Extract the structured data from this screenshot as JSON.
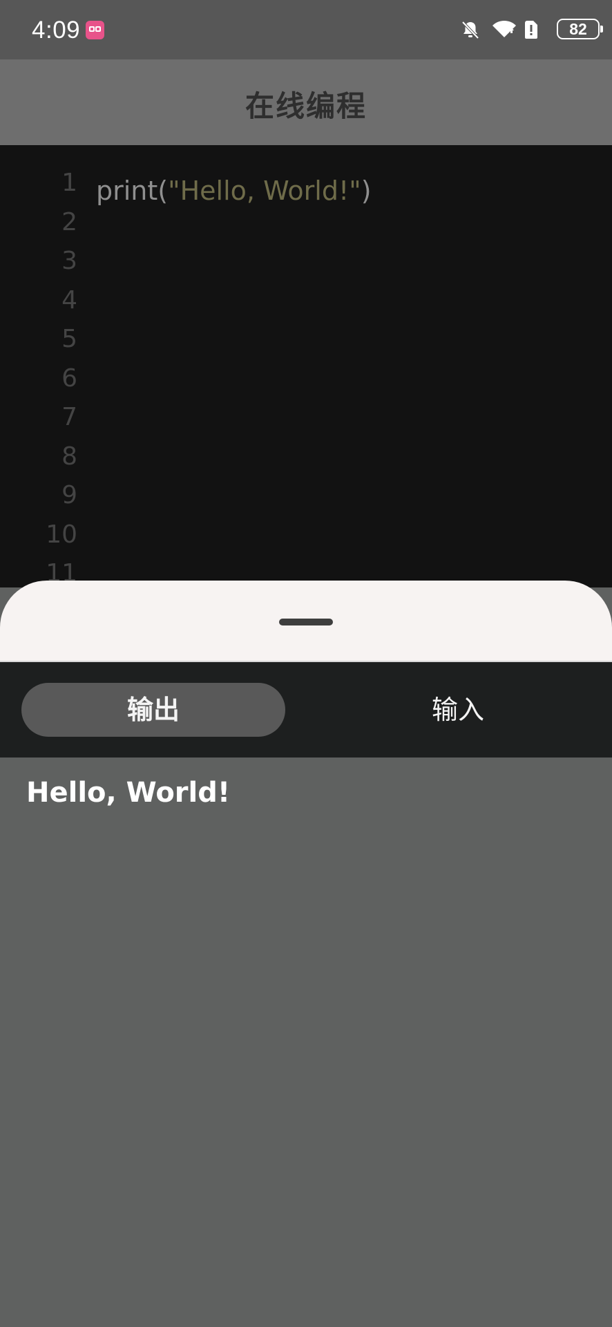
{
  "status_bar": {
    "time": "4:09",
    "battery": "82",
    "icons": [
      "app-badge-icon",
      "bell-mute-icon",
      "wifi-icon",
      "alert-icon",
      "battery-icon"
    ]
  },
  "header": {
    "title": "在线编程"
  },
  "editor": {
    "line_numbers": [
      "1",
      "2",
      "3",
      "4",
      "5",
      "6",
      "7",
      "8",
      "9",
      "10",
      "11"
    ],
    "code": {
      "func": "print(",
      "string": "\"Hello, World!\"",
      "close": ")"
    }
  },
  "tabs": {
    "output_label": "输出",
    "input_label": "输入",
    "active": "output"
  },
  "output": {
    "text": "Hello, World!"
  },
  "colors": {
    "editor_bg": "#121212",
    "string_color": "#6f6c4a",
    "tab_active_bg": "#595959",
    "sheet_bg": "#f7f3f2"
  }
}
